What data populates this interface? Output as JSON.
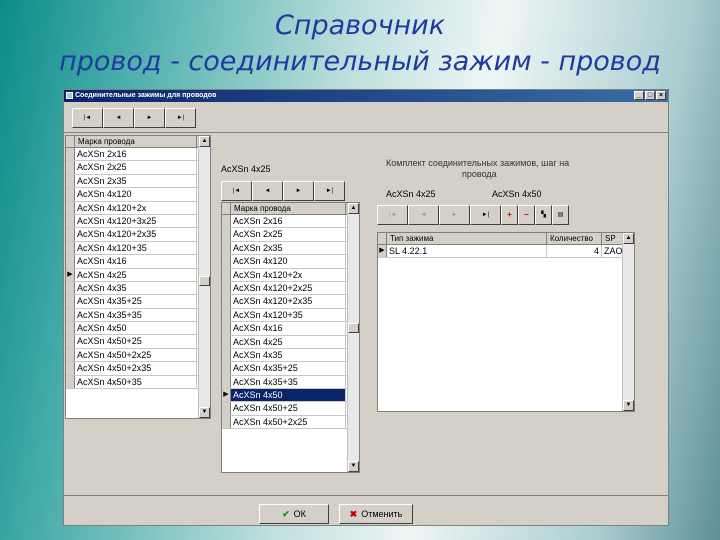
{
  "slide": {
    "title_line1": "Справочник",
    "title_line2": "провод - соединительный зажим - провод"
  },
  "window": {
    "title": "Соединительные зажимы для проводов",
    "buttons": [
      "_",
      "□",
      "×"
    ]
  },
  "nav": {
    "first": "|◄",
    "prev": "◄",
    "next": "►",
    "last": "►|",
    "add": "+",
    "delete": "−",
    "icon_a": "▚",
    "icon_b": "▤"
  },
  "left_grid": {
    "header": "Марка провода",
    "rows": [
      "АсХSn 2х16",
      "АсХSn 2х25",
      "АсХSn 2х35",
      "АсХSn 4х120",
      "АсХSn 4х120+2х",
      "АсХSn 4х120+3х25",
      "АсХSn 4х120+2х35",
      "АсХSn 4х120+35",
      "АсХSn 4х16",
      "АсХSn 4х25",
      "АсХSn 4х35",
      "АсХSn 4х35+25",
      "АсХSn 4х35+35",
      "АсХSn 4х50",
      "АсХSn 4х50+25",
      "АсХSn 4х50+2х25",
      "АсХSn 4х50+2х35",
      "АсХSn 4х50+35"
    ],
    "current_row": 9
  },
  "middle": {
    "selected_label": "АсХSn 4х25",
    "grid_header": "Марка провода",
    "rows": [
      "АсХSn 2х16",
      "АсХSn 2х25",
      "АсХSn 2х35",
      "АсХSn 4х120",
      "АсХSn 4х120+2х",
      "АсХSn 4х120+2х25",
      "АсХSn 4х120+2х35",
      "АсХSn 4х120+35",
      "АсХSn 4х16",
      "АсХSn 4х25",
      "АсХSn 4х35",
      "АсХSn 4х35+25",
      "АсХSn 4х35+35",
      "АсХSn 4х50",
      "АсХSn 4х50+25",
      "АсХSn 4х50+2х25"
    ],
    "selected_row": 13
  },
  "right": {
    "caption_line1": "Комплект соединительных зажимов, шаг на",
    "caption_line2": "провода",
    "wire_a": "АсХSn 4х25",
    "wire_b": "АсХSn 4х50",
    "grid_headers": [
      "Тип зажима",
      "Количество",
      "SP"
    ],
    "rows": [
      {
        "type": "SL 4.22.1",
        "qty": "4",
        "sp": "ZAO"
      }
    ]
  },
  "footer": {
    "ok_icon": "✔",
    "ok_label": "ОК",
    "cancel_icon": "✖",
    "cancel_label": "Отменить"
  }
}
